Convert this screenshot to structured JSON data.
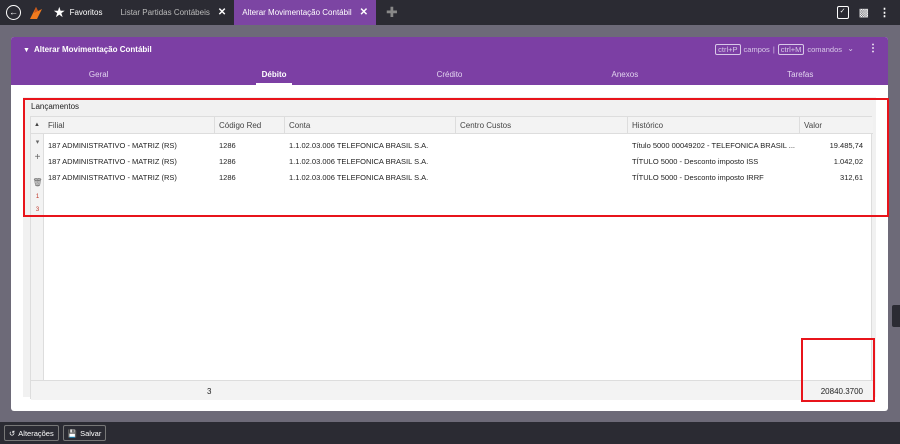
{
  "topbar": {
    "favorites_label": "Favoritos",
    "tabs": [
      {
        "label": "Listar Partidas Contábeis",
        "close": "✕"
      },
      {
        "label": "Alterar Movimentação Contábil",
        "close": "✕"
      }
    ]
  },
  "panel": {
    "title": "Alterar Movimentação Contábil",
    "shortcut_campos_key": "ctrl+P",
    "shortcut_campos_label": "campos",
    "shortcut_sep": "|",
    "shortcut_comandos_key": "ctrl+M",
    "shortcut_comandos_label": "comandos",
    "tabs": [
      "Geral",
      "Débito",
      "Crédito",
      "Anexos",
      "Tarefas"
    ]
  },
  "section_title": "Lançamentos",
  "table": {
    "headers": [
      "Filial",
      "Código Red",
      "Conta",
      "Centro Custos",
      "Histórico",
      "Valor"
    ],
    "rows": [
      [
        "187 ADMINISTRATIVO - MATRIZ (RS)",
        "1286",
        "1.1.02.03.006 TELEFONICA BRASIL S.A.",
        "",
        "Título 5000 00049202 - TELEFONICA BRASIL ...",
        "19.485,74"
      ],
      [
        "187 ADMINISTRATIVO - MATRIZ (RS)",
        "1286",
        "1.1.02.03.006 TELEFONICA BRASIL S.A.",
        "",
        "TÍTULO 5000 - Desconto imposto ISS",
        "1.042,02"
      ],
      [
        "187 ADMINISTRATIVO - MATRIZ (RS)",
        "1286",
        "1.1.02.03.006 TELEFONICA BRASIL S.A.",
        "",
        "TÍTULO 5000 - Desconto imposto IRRF",
        "312,61"
      ]
    ],
    "side_labels": [
      "1",
      "3"
    ],
    "footer_count": "3",
    "footer_total": "20840.3700"
  },
  "bottombar": {
    "alteracoes_label": "Alterações",
    "salvar_label": "Salvar"
  },
  "colors": {
    "accent": "#7c3fa4",
    "highlight": "#e8141b"
  }
}
